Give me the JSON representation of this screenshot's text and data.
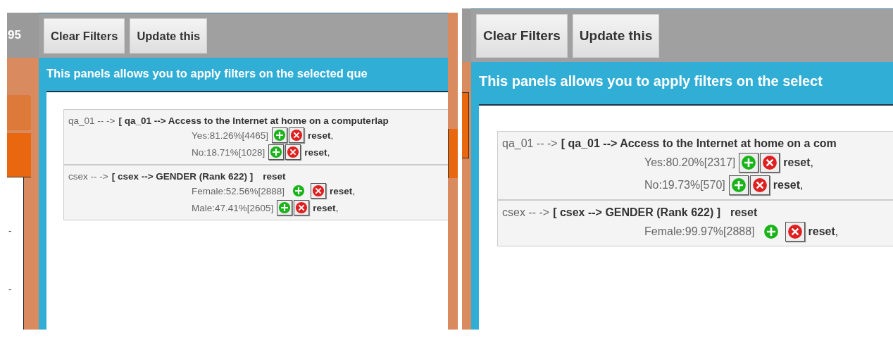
{
  "screens": [
    {
      "kind": "compact",
      "side_label": "95",
      "side_marks": [
        "-",
        "-"
      ],
      "buttons": [
        "Clear Filters",
        "Update this"
      ],
      "banner": "This panels allows you to apply filters on the selected que",
      "filters": [
        {
          "variable": "qa_01 -- ->",
          "question": "[ qa_01 --> Access to the Internet at home on a computerlap",
          "options": [
            {
              "label": "Yes:81.26%[4465]",
              "plus_framed": true,
              "reset": "**reset**,"
            },
            {
              "label": "No:18.71%[1028]",
              "plus_framed": true,
              "reset": "**reset**,"
            }
          ]
        },
        {
          "variable": "csex -- ->",
          "question": "[ csex --> GENDER (Rank 622) ]",
          "reset": "reset",
          "options": [
            {
              "label": "Female:52.56%[2888]",
              "plus_framed": false,
              "reset": "**reset**,"
            },
            {
              "label": "Male:47.41%[2605]",
              "plus_framed": true,
              "reset": "**reset**,"
            }
          ]
        }
      ]
    },
    {
      "kind": "zoomed",
      "buttons": [
        "Clear Filters",
        "Update this"
      ],
      "banner": "This panels allows you to apply filters on the select",
      "filters": [
        {
          "variable": "qa_01 -- ->",
          "question": "[ qa_01 --> Access to the Internet at home on a com",
          "options": [
            {
              "label": "Yes:80.20%[2317]",
              "plus_framed": true,
              "reset": "**reset**,"
            },
            {
              "label": "No:19.73%[570]",
              "plus_framed": true,
              "reset": "**reset**,"
            }
          ]
        },
        {
          "variable": "csex -- ->",
          "question": "[ csex --> GENDER (Rank 622) ]",
          "reset": "reset",
          "options": [
            {
              "label": "Female:99.97%[2888]",
              "plus_framed": false,
              "reset": "**reset**,"
            }
          ]
        }
      ]
    }
  ]
}
